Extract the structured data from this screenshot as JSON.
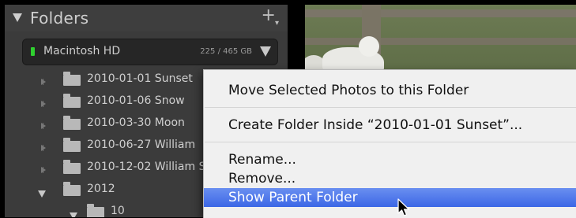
{
  "panel": {
    "title": "Folders",
    "add_glyph": "+",
    "add_sub_glyph": "▾",
    "volume": {
      "name": "Macintosh HD",
      "usage": "225 / 465 GB",
      "status_color": "#2fd02f"
    },
    "folders": [
      {
        "label": "2010-01-01 Sunset",
        "expanded": false
      },
      {
        "label": "2010-01-06 Snow",
        "expanded": false
      },
      {
        "label": "2010-03-30 Moon",
        "expanded": false
      },
      {
        "label": "2010-06-27 William",
        "expanded": false
      },
      {
        "label": "2010-12-02 William S",
        "expanded": false
      },
      {
        "label": "2012",
        "expanded": true
      },
      {
        "label": "10",
        "expanded": true
      }
    ]
  },
  "context_menu": {
    "items": [
      {
        "label": "Move Selected Photos to this Folder"
      },
      {
        "label": "Create Folder Inside “2010-01-01 Sunset”..."
      },
      {
        "label": "Rename..."
      },
      {
        "label": "Remove..."
      },
      {
        "label": "Show Parent Folder",
        "selected": true
      }
    ],
    "highlight_color": "#3b67e6"
  }
}
